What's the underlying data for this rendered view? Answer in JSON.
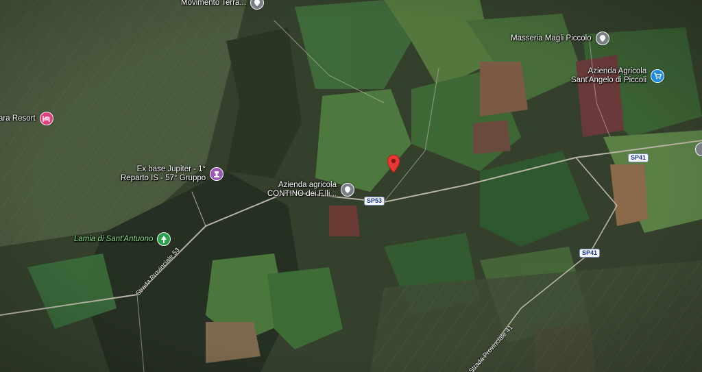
{
  "map": {
    "type": "satellite",
    "marker_color": "#e53935",
    "pois": [
      {
        "id": "movimento",
        "label": [
          "Movimento Terra..."
        ],
        "icon": "gray-pin-icon",
        "color": "#7a7f86"
      },
      {
        "id": "masseria",
        "label": [
          "Masseria Magli Piccolo"
        ],
        "icon": "gray-pin-icon",
        "color": "#7a7f86"
      },
      {
        "id": "azienda-sant-angelo",
        "label": [
          "Azienda Agricola",
          "Sant'Angelo di Piccoli"
        ],
        "icon": "shopping-cart-icon",
        "color": "#1e88e5"
      },
      {
        "id": "resort",
        "label": [
          "ara Resort"
        ],
        "icon": "hotel-icon",
        "color": "#e0407c"
      },
      {
        "id": "jupiter",
        "label": [
          "Ex base Jupiter - 1°",
          "Reparto IS - 57° Gruppo"
        ],
        "icon": "landmark-icon",
        "color": "#9b59b6"
      },
      {
        "id": "contino",
        "label": [
          "Azienda agricola",
          "CONTINO dei F.lli..."
        ],
        "icon": "gray-pin-icon",
        "color": "#7a7f86"
      },
      {
        "id": "lamia",
        "label": [
          "Lamia di Sant'Antuono"
        ],
        "icon": "park-icon",
        "color": "#2e9e4f"
      }
    ],
    "road_shields": [
      "SP41",
      "SP53",
      "SP41"
    ],
    "road_labels": [
      "Strada Provinciale 53",
      "Strada Provinciale 41"
    ]
  }
}
